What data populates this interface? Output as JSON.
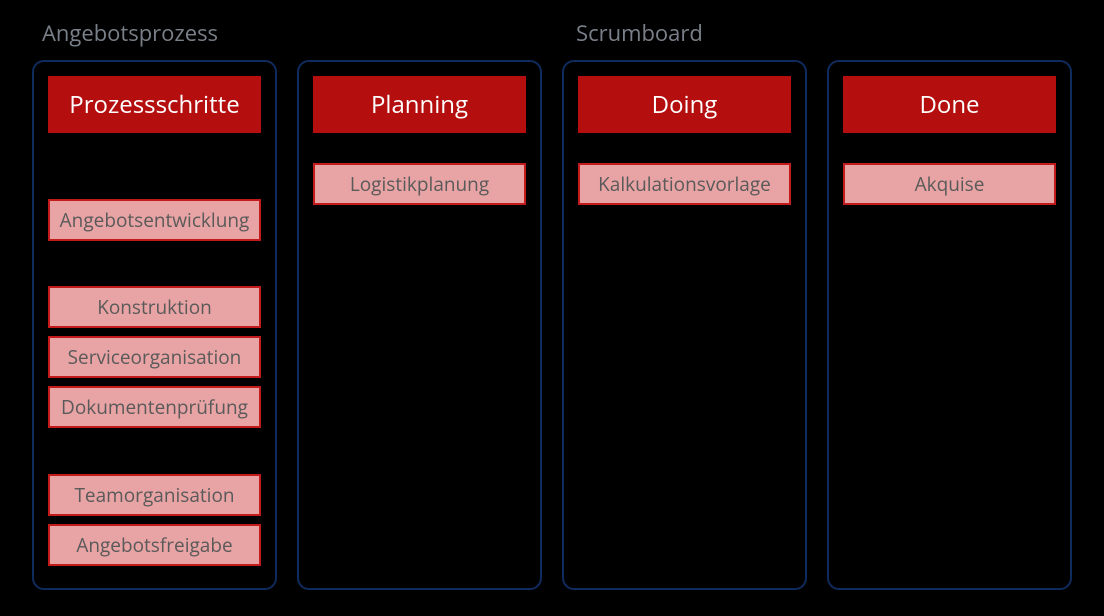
{
  "labels": {
    "left": "Angebotsprozess",
    "right": "Scrumboard"
  },
  "columns": [
    {
      "header": "Prozessschritte",
      "slots": [
        {
          "type": "spacer",
          "size": "sm"
        },
        {
          "type": "card",
          "text": "Angebotsentwicklung"
        },
        {
          "type": "spacer",
          "size": "md"
        },
        {
          "type": "card",
          "text": "Konstruktion"
        },
        {
          "type": "card",
          "text": "Serviceorganisation"
        },
        {
          "type": "card",
          "text": "Dokumentenprüfung"
        },
        {
          "type": "spacer",
          "size": "md"
        },
        {
          "type": "card",
          "text": "Teamorganisation"
        },
        {
          "type": "card",
          "text": "Angebotsfreigabe"
        }
      ]
    },
    {
      "header": "Planning",
      "slots": [
        {
          "type": "card",
          "text": "Logistikplanung"
        }
      ]
    },
    {
      "header": "Doing",
      "slots": [
        {
          "type": "card",
          "text": "Kalkulationsvorlage"
        }
      ]
    },
    {
      "header": "Done",
      "slots": [
        {
          "type": "card",
          "text": "Akquise"
        }
      ]
    }
  ]
}
